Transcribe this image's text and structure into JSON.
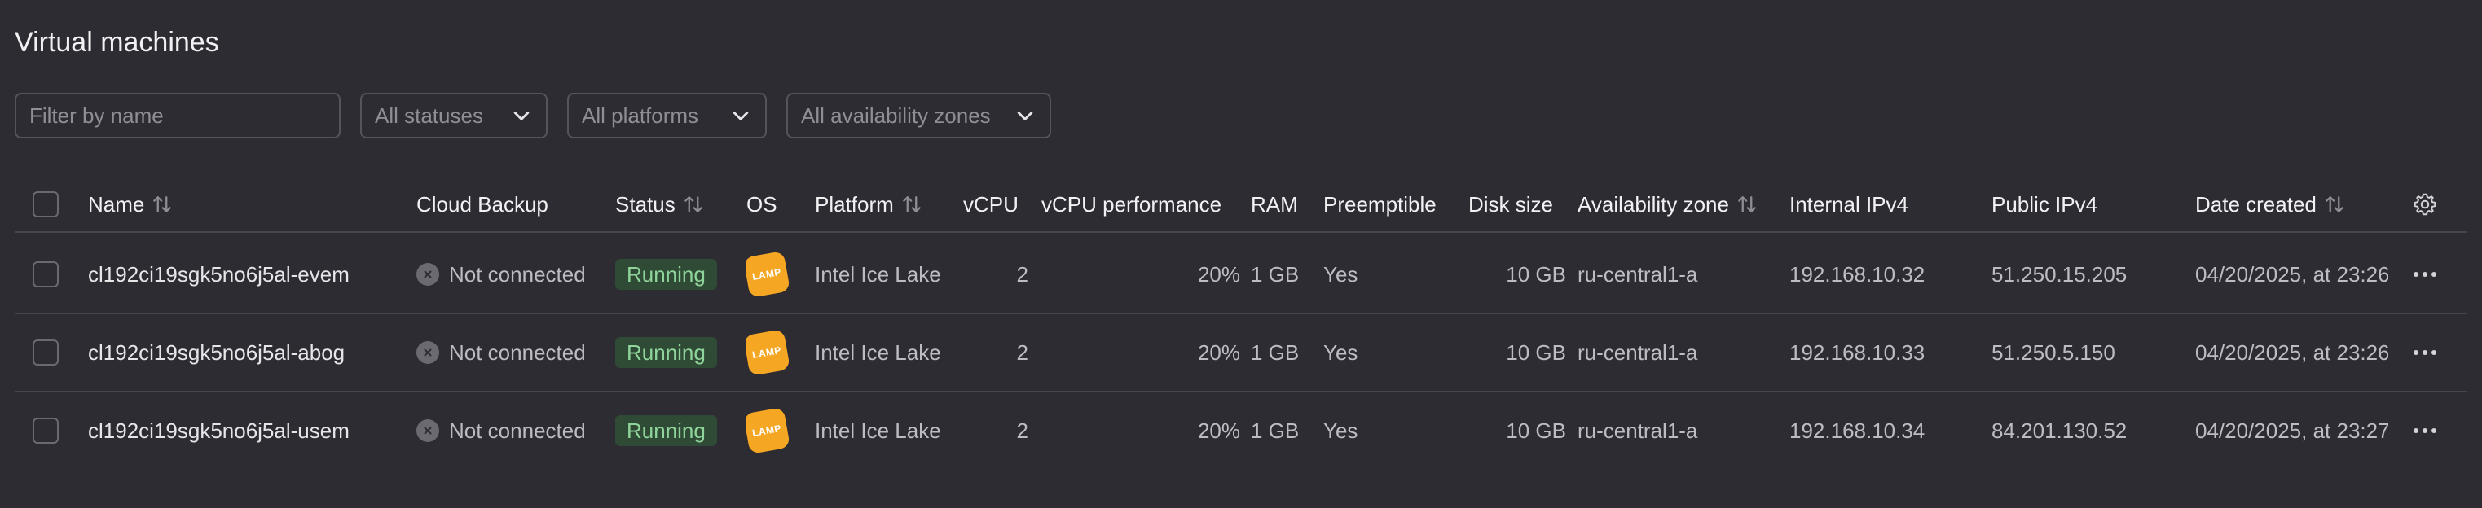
{
  "page": {
    "title": "Virtual machines"
  },
  "filters": {
    "name_placeholder": "Filter by name",
    "status": "All statuses",
    "platform": "All platforms",
    "zone": "All availability zones"
  },
  "table": {
    "columns": {
      "name": "Name",
      "cloud_backup": "Cloud Backup",
      "status": "Status",
      "os": "OS",
      "platform": "Platform",
      "vcpu": "vCPU",
      "vcpu_performance": "vCPU performance",
      "ram": "RAM",
      "preemptible": "Preemptible",
      "disk_size": "Disk size",
      "availability_zone": "Availability zone",
      "internal_ipv4": "Internal IPv4",
      "public_ipv4": "Public IPv4",
      "date_created": "Date created"
    },
    "rows": [
      {
        "name": "cl192ci19sgk5no6j5al-evem",
        "cloud_backup": "Not connected",
        "status": "Running",
        "os": "LAMP",
        "platform": "Intel Ice Lake",
        "vcpu": "2",
        "vcpu_performance": "20%",
        "ram": "1 GB",
        "preemptible": "Yes",
        "disk_size": "10 GB",
        "availability_zone": "ru-central1-a",
        "internal_ipv4": "192.168.10.32",
        "public_ipv4": "51.250.15.205",
        "date_created": "04/20/2025, at 23:26"
      },
      {
        "name": "cl192ci19sgk5no6j5al-abog",
        "cloud_backup": "Not connected",
        "status": "Running",
        "os": "LAMP",
        "platform": "Intel Ice Lake",
        "vcpu": "2",
        "vcpu_performance": "20%",
        "ram": "1 GB",
        "preemptible": "Yes",
        "disk_size": "10 GB",
        "availability_zone": "ru-central1-a",
        "internal_ipv4": "192.168.10.33",
        "public_ipv4": "51.250.5.150",
        "date_created": "04/20/2025, at 23:26"
      },
      {
        "name": "cl192ci19sgk5no6j5al-usem",
        "cloud_backup": "Not connected",
        "status": "Running",
        "os": "LAMP",
        "platform": "Intel Ice Lake",
        "vcpu": "2",
        "vcpu_performance": "20%",
        "ram": "1 GB",
        "preemptible": "Yes",
        "disk_size": "10 GB",
        "availability_zone": "ru-central1-a",
        "internal_ipv4": "192.168.10.34",
        "public_ipv4": "84.201.130.52",
        "date_created": "04/20/2025, at 23:27"
      }
    ]
  },
  "icons": {
    "sort": "sort-arrows-icon",
    "settings": "gear-icon",
    "row_menu": "more-horizontal-icon",
    "not_connected": "close-circle-icon",
    "os": "lamp-logo-icon",
    "dropdown": "chevron-down-icon"
  },
  "colors": {
    "background": "#2d2c33",
    "status_running_bg": "#2f4a35",
    "status_running_text": "#8fd49a",
    "os_badge": "#f5a623"
  }
}
